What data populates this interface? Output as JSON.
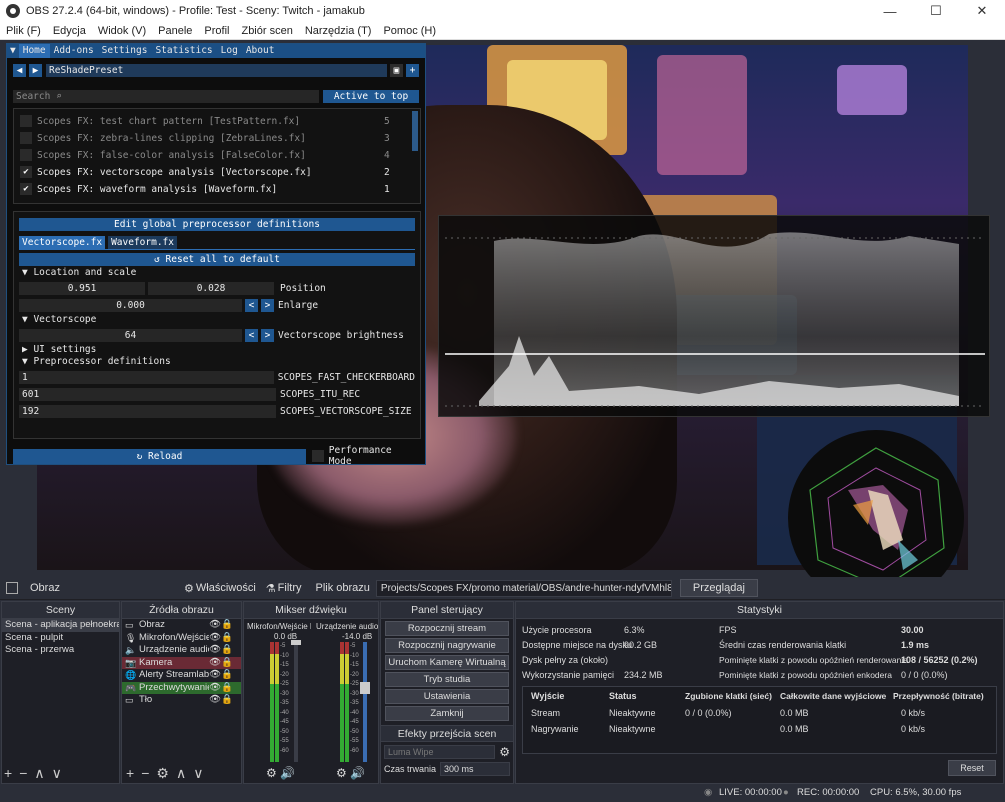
{
  "window": {
    "title": "OBS 27.2.4 (64-bit, windows) - Profile: Test - Sceny: Twitch - jamakub",
    "controls": [
      "—",
      "☐",
      "✕"
    ]
  },
  "menu": [
    "Plik (F)",
    "Edycja",
    "Widok (V)",
    "Panele",
    "Profil",
    "Zbiór scen",
    "Narzędzia (T)",
    "Pomoc (H)"
  ],
  "reshade": {
    "tabs": [
      "Home",
      "Add-ons",
      "Settings",
      "Statistics",
      "Log",
      "About"
    ],
    "preset": "ReShadePreset",
    "search_placeholder": "Search",
    "active_to_top": "Active to top",
    "effects": [
      {
        "label": "Scopes FX: test chart pattern [TestPattern.fx]",
        "order": "5",
        "checked": false
      },
      {
        "label": "Scopes FX: zebra-lines clipping [ZebraLines.fx]",
        "order": "3",
        "checked": false
      },
      {
        "label": "Scopes FX: false-color analysis [FalseColor.fx]",
        "order": "4",
        "checked": false
      },
      {
        "label": "Scopes FX: vectorscope analysis [Vectorscope.fx]",
        "order": "2",
        "checked": true
      },
      {
        "label": "Scopes FX: waveform analysis [Waveform.fx]",
        "order": "1",
        "checked": true
      }
    ],
    "edit_global": "Edit global preprocessor definitions",
    "fx_tabs": [
      "Vectorscope.fx",
      "Waveform.fx"
    ],
    "reset_all": "Reset all to default",
    "location_header": "Location and scale",
    "pos_x": "0.951",
    "pos_y": "0.028",
    "position_label": "Position",
    "enlarge_val": "0.000",
    "enlarge_label": "Enlarge",
    "vectorscope_header": "Vectorscope",
    "brightness_val": "64",
    "brightness_label": "Vectorscope brightness",
    "ui_settings": "UI settings",
    "preproc_header": "Preprocessor definitions",
    "defs": [
      {
        "value": "1",
        "name": "SCOPES_FAST_CHECKERBOARD"
      },
      {
        "value": "601",
        "name": "SCOPES_ITU_REC"
      },
      {
        "value": "192",
        "name": "SCOPES_VECTORSCOPE_SIZE"
      }
    ],
    "reload": "Reload",
    "performance_mode": "Performance Mode"
  },
  "source_bar": {
    "source": "Obraz",
    "properties": "Właściwości",
    "filters": "Filtry",
    "file_label": "Plik obrazu",
    "file_path": "Projects/Scopes FX/promo material/OBS/andre-hunter-ndyfVMhl8qI-unsplash.jpg",
    "browse": "Przeglądaj"
  },
  "scenes": {
    "title": "Sceny",
    "items": [
      "Scena - aplikacja pełnoekranowa",
      "Scena - pulpit",
      "Scena - przerwa"
    ]
  },
  "sources": {
    "title": "Źródła obrazu",
    "items": [
      "Obraz",
      "Mikrofon/Wejście liniowe",
      "Urządzenie audio",
      "Kamera",
      "Alerty Streamlabs",
      "Przechwytywanie",
      "Tło"
    ]
  },
  "mixer": {
    "title": "Mikser dźwięku",
    "channels": [
      {
        "name": "Mikrofon/Wejście liniowe",
        "db": "0.0 dB"
      },
      {
        "name": "Urządzenie audio",
        "db": "-14.0 dB"
      }
    ],
    "ticks": [
      "-5",
      "-10",
      "-15",
      "-20",
      "-25",
      "-30",
      "-35",
      "-40",
      "-45",
      "-50",
      "-55",
      "-60"
    ]
  },
  "controls": {
    "title": "Panel sterujący",
    "buttons": [
      "Rozpocznij stream",
      "Rozpocznij nagrywanie",
      "Uruchom Kamerę Wirtualną",
      "Tryb studia",
      "Ustawienia",
      "Zamknij"
    ],
    "transitions_title": "Efekty przejścia scen",
    "transition": "Luma Wipe",
    "duration_label": "Czas trwania",
    "duration": "300 ms"
  },
  "stats": {
    "title": "Statystyki",
    "left": [
      [
        "Użycie procesora",
        "6.3%"
      ],
      [
        "Dostępne miejsce na dysku",
        "90.2 GB"
      ],
      [
        "Dysk pełny za (około)",
        ""
      ],
      [
        "Wykorzystanie pamięci",
        "234.2 MB"
      ]
    ],
    "right": [
      [
        "FPS",
        "30.00"
      ],
      [
        "Średni czas renderowania klatki",
        "1.9 ms"
      ],
      [
        "Pominięte klatki z powodu opóźnień renderowania",
        "108 / 56252 (0.2%)"
      ],
      [
        "Pominięte klatki z powodu opóźnień enkodera",
        "0 / 0 (0.0%)"
      ]
    ],
    "table_headers": [
      "Wyjście",
      "Status",
      "Zgubione klatki (sieć)",
      "Całkowite dane wyjściowe",
      "Przepływność (bitrate)"
    ],
    "rows": [
      [
        "Stream",
        "Nieaktywne",
        "0 / 0 (0.0%)",
        "0.0 MB",
        "0 kb/s"
      ],
      [
        "Nagrywanie",
        "Nieaktywne",
        "",
        "0.0 MB",
        "0 kb/s"
      ]
    ],
    "reset": "Reset"
  },
  "status": {
    "live": "LIVE: 00:00:00",
    "rec": "REC: 00:00:00",
    "cpu": "CPU: 6.5%, 30.00 fps"
  }
}
